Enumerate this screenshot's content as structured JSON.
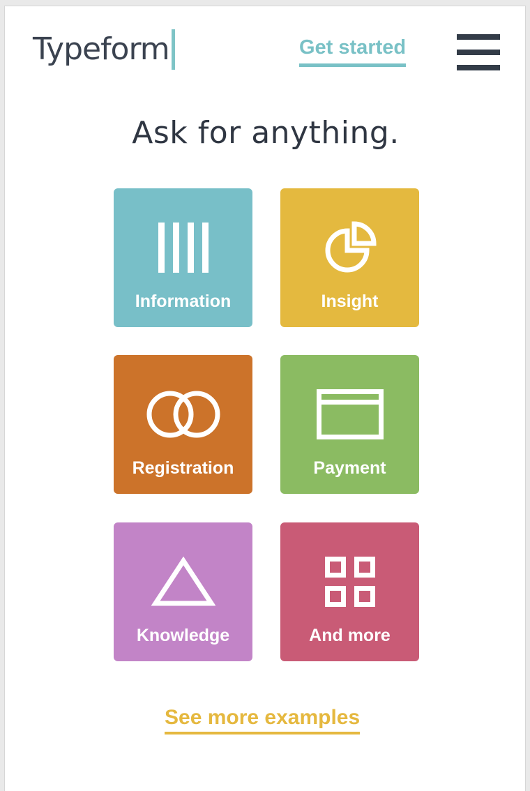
{
  "header": {
    "logo_text": "Typeform",
    "cta_label": "Get started",
    "menu_icon": "hamburger-menu-icon"
  },
  "main": {
    "headline": "Ask for anything.",
    "tiles": [
      {
        "label": "Information",
        "icon": "vertical-bars-icon",
        "color": "#78bfc8"
      },
      {
        "label": "Insight",
        "icon": "pie-chart-icon",
        "color": "#e4b93f"
      },
      {
        "label": "Registration",
        "icon": "interlocking-rings-icon",
        "color": "#cc732a"
      },
      {
        "label": "Payment",
        "icon": "credit-card-icon",
        "color": "#8bbb62"
      },
      {
        "label": "Knowledge",
        "icon": "triangle-icon",
        "color": "#c284c7"
      },
      {
        "label": "And more",
        "icon": "grid-squares-icon",
        "color": "#c95b76"
      }
    ],
    "see_more_label": "See more examples"
  },
  "colors": {
    "brand_accent": "#79c1c6",
    "link_yellow": "#e5b83f",
    "text_dark": "#2f3642"
  }
}
